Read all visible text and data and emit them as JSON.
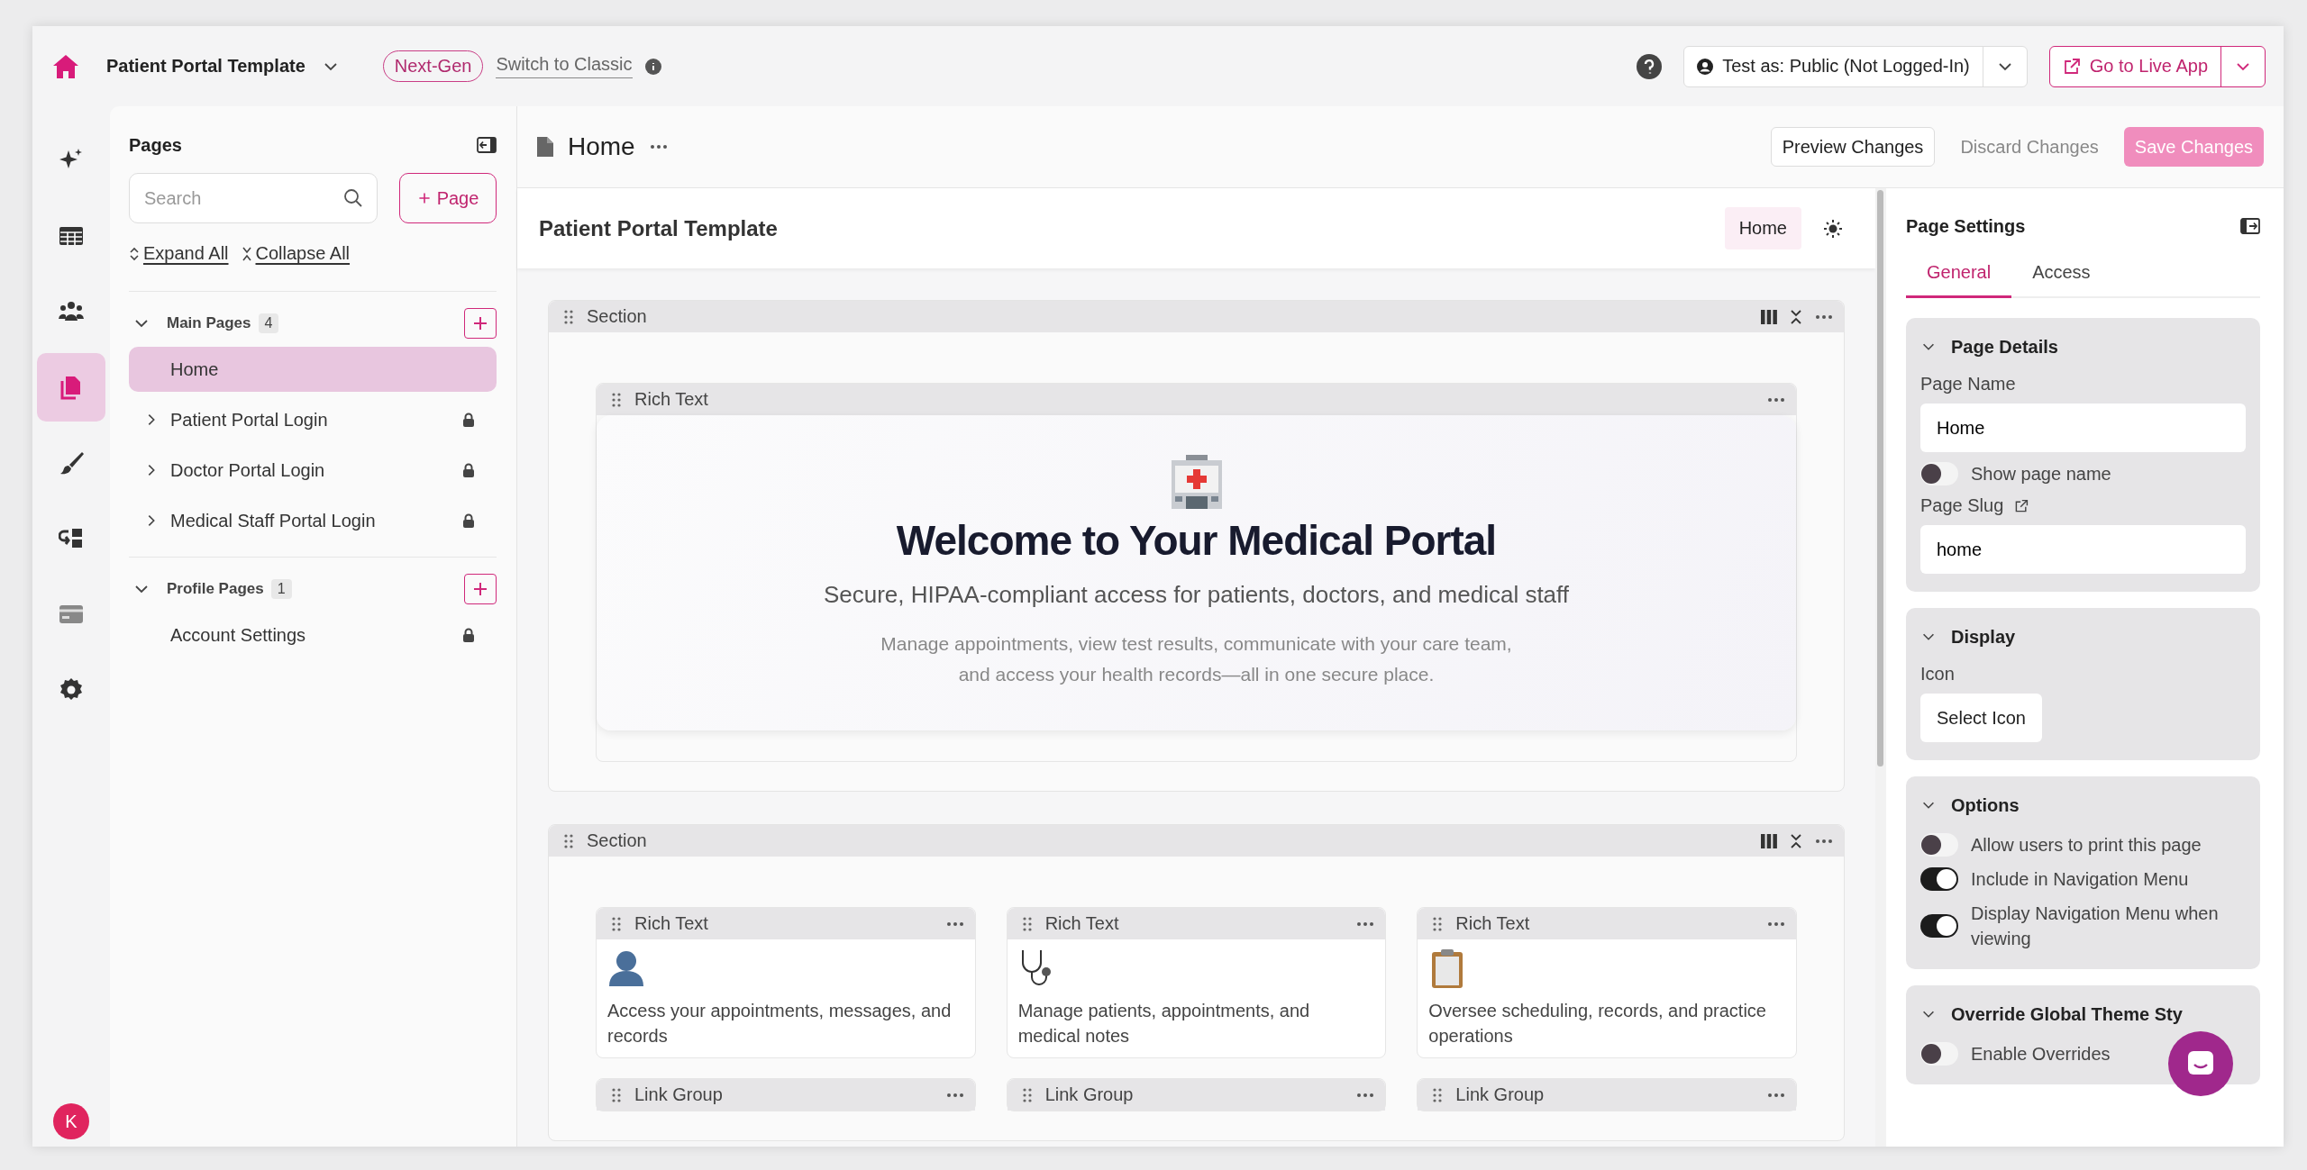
{
  "top_bar": {
    "app_name": "Patient Portal Template",
    "badge": "Next-Gen",
    "switch_link": "Switch to Classic",
    "test_as": "Test as: Public (Not Logged-In)",
    "live_button": "Go to Live App"
  },
  "rail": [
    {
      "kind": "ai",
      "selected": false
    },
    {
      "kind": "data",
      "selected": false
    },
    {
      "kind": "users",
      "selected": false
    },
    {
      "kind": "pages",
      "selected": true
    },
    {
      "kind": "design",
      "selected": false
    },
    {
      "kind": "workflows",
      "selected": false
    },
    {
      "kind": "billing",
      "selected": false
    },
    {
      "kind": "settings",
      "selected": false
    }
  ],
  "user_avatar": {
    "initial": "K"
  },
  "pages_panel": {
    "title": "Pages",
    "search": {
      "placeholder": "Search"
    },
    "add_button": "Page",
    "expand_all": "Expand All",
    "collapse_all": "Collapse All",
    "groups": [
      {
        "label": "Main Pages",
        "count": "4",
        "expanded": true,
        "children": [
          {
            "label": "Home",
            "kind": "page",
            "selected": true,
            "locked": false
          },
          {
            "label": "Patient Portal Login",
            "kind": "folder",
            "expanded": false,
            "selected": false,
            "locked": true
          },
          {
            "label": "Doctor Portal Login",
            "kind": "folder",
            "expanded": false,
            "selected": false,
            "locked": true
          },
          {
            "label": "Medical Staff Portal Login",
            "kind": "folder",
            "expanded": false,
            "selected": false,
            "locked": true
          }
        ]
      },
      {
        "label": "Profile Pages",
        "count": "1",
        "expanded": true,
        "children": [
          {
            "label": "Account Settings",
            "kind": "page",
            "selected": false,
            "locked": true
          }
        ]
      }
    ]
  },
  "page_header": {
    "title": "Home",
    "buttons": [
      {
        "label": "Preview Changes",
        "kind": "secondary",
        "disabled": false
      },
      {
        "label": "Discard Changes",
        "kind": "text",
        "disabled": true
      },
      {
        "label": "Save Changes",
        "kind": "primary",
        "disabled": true
      }
    ]
  },
  "canvas": {
    "title": "Patient Portal Template",
    "page_chip": "Home",
    "sections": [
      {
        "label": "Section",
        "blocks": [
          {
            "kind": "hero",
            "label": "Rich Text",
            "heading": "Welcome to Your Medical Portal",
            "subheading": "Secure, HIPAA-compliant access for patients, doctors, and medical staff",
            "body": "Manage appointments, view test results, communicate with your care team, and access your health records—all in one secure place."
          }
        ]
      },
      {
        "label": "Section",
        "blocks": [
          {
            "kind": "feature",
            "label": "Rich Text",
            "text": "Access your appointments, messages, and records"
          },
          {
            "kind": "feature",
            "label": "Rich Text",
            "text": "Manage patients, appointments, and medical notes"
          },
          {
            "kind": "feature",
            "label": "Rich Text",
            "text": "Oversee scheduling, records, and practice operations"
          },
          {
            "kind": "link_group",
            "label": "Link Group"
          },
          {
            "kind": "link_group",
            "label": "Link Group"
          },
          {
            "kind": "link_group",
            "label": "Link Group"
          }
        ]
      }
    ]
  },
  "settings_panel": {
    "title": "Page Settings",
    "tabs": [
      {
        "label": "General",
        "selected": true
      },
      {
        "label": "Access",
        "selected": false
      }
    ],
    "sections": [
      {
        "title": "Page Details",
        "expanded": true,
        "rows": [
          {
            "kind": "label",
            "text": "Page Name"
          },
          {
            "kind": "field",
            "value": "Home"
          },
          {
            "kind": "toggle",
            "label": "Show page name",
            "on": false
          },
          {
            "kind": "label_link",
            "text": "Page Slug"
          },
          {
            "kind": "field",
            "value": "home"
          }
        ]
      },
      {
        "title": "Display",
        "expanded": true,
        "rows": [
          {
            "kind": "label",
            "text": "Icon"
          },
          {
            "kind": "button",
            "label": "Select Icon"
          }
        ]
      },
      {
        "title": "Options",
        "expanded": true,
        "rows": [
          {
            "kind": "toggle",
            "label": "Allow users to print this page",
            "on": false
          },
          {
            "kind": "toggle",
            "label": "Include in Navigation Menu",
            "on": true
          },
          {
            "kind": "toggle",
            "label": "Display Navigation Menu when viewing",
            "on": true
          }
        ]
      },
      {
        "title": "Override Global Theme Sty",
        "expanded": true,
        "rows": [
          {
            "kind": "toggle",
            "label": "Enable Overrides",
            "on": false
          }
        ]
      }
    ]
  }
}
